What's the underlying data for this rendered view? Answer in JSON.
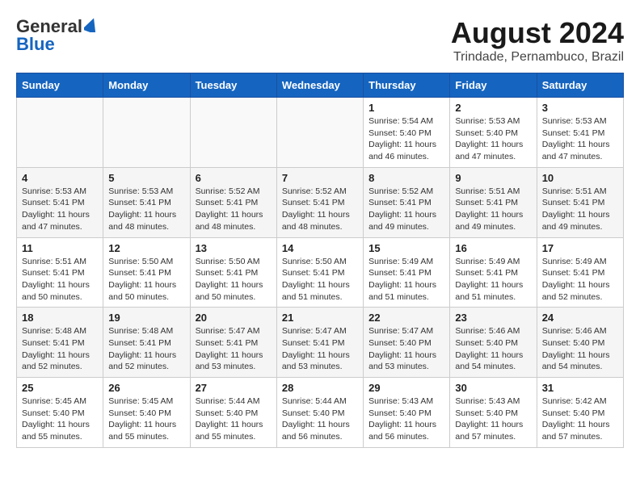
{
  "header": {
    "logo_line1": "General",
    "logo_line2": "Blue",
    "title": "August 2024",
    "subtitle": "Trindade, Pernambuco, Brazil"
  },
  "calendar": {
    "days_of_week": [
      "Sunday",
      "Monday",
      "Tuesday",
      "Wednesday",
      "Thursday",
      "Friday",
      "Saturday"
    ],
    "weeks": [
      [
        {
          "day": "",
          "empty": true
        },
        {
          "day": "",
          "empty": true
        },
        {
          "day": "",
          "empty": true
        },
        {
          "day": "",
          "empty": true
        },
        {
          "day": "1",
          "sunrise": "Sunrise: 5:54 AM",
          "sunset": "Sunset: 5:40 PM",
          "daylight": "Daylight: 11 hours and 46 minutes."
        },
        {
          "day": "2",
          "sunrise": "Sunrise: 5:53 AM",
          "sunset": "Sunset: 5:40 PM",
          "daylight": "Daylight: 11 hours and 47 minutes."
        },
        {
          "day": "3",
          "sunrise": "Sunrise: 5:53 AM",
          "sunset": "Sunset: 5:41 PM",
          "daylight": "Daylight: 11 hours and 47 minutes."
        }
      ],
      [
        {
          "day": "4",
          "sunrise": "Sunrise: 5:53 AM",
          "sunset": "Sunset: 5:41 PM",
          "daylight": "Daylight: 11 hours and 47 minutes."
        },
        {
          "day": "5",
          "sunrise": "Sunrise: 5:53 AM",
          "sunset": "Sunset: 5:41 PM",
          "daylight": "Daylight: 11 hours and 48 minutes."
        },
        {
          "day": "6",
          "sunrise": "Sunrise: 5:52 AM",
          "sunset": "Sunset: 5:41 PM",
          "daylight": "Daylight: 11 hours and 48 minutes."
        },
        {
          "day": "7",
          "sunrise": "Sunrise: 5:52 AM",
          "sunset": "Sunset: 5:41 PM",
          "daylight": "Daylight: 11 hours and 48 minutes."
        },
        {
          "day": "8",
          "sunrise": "Sunrise: 5:52 AM",
          "sunset": "Sunset: 5:41 PM",
          "daylight": "Daylight: 11 hours and 49 minutes."
        },
        {
          "day": "9",
          "sunrise": "Sunrise: 5:51 AM",
          "sunset": "Sunset: 5:41 PM",
          "daylight": "Daylight: 11 hours and 49 minutes."
        },
        {
          "day": "10",
          "sunrise": "Sunrise: 5:51 AM",
          "sunset": "Sunset: 5:41 PM",
          "daylight": "Daylight: 11 hours and 49 minutes."
        }
      ],
      [
        {
          "day": "11",
          "sunrise": "Sunrise: 5:51 AM",
          "sunset": "Sunset: 5:41 PM",
          "daylight": "Daylight: 11 hours and 50 minutes."
        },
        {
          "day": "12",
          "sunrise": "Sunrise: 5:50 AM",
          "sunset": "Sunset: 5:41 PM",
          "daylight": "Daylight: 11 hours and 50 minutes."
        },
        {
          "day": "13",
          "sunrise": "Sunrise: 5:50 AM",
          "sunset": "Sunset: 5:41 PM",
          "daylight": "Daylight: 11 hours and 50 minutes."
        },
        {
          "day": "14",
          "sunrise": "Sunrise: 5:50 AM",
          "sunset": "Sunset: 5:41 PM",
          "daylight": "Daylight: 11 hours and 51 minutes."
        },
        {
          "day": "15",
          "sunrise": "Sunrise: 5:49 AM",
          "sunset": "Sunset: 5:41 PM",
          "daylight": "Daylight: 11 hours and 51 minutes."
        },
        {
          "day": "16",
          "sunrise": "Sunrise: 5:49 AM",
          "sunset": "Sunset: 5:41 PM",
          "daylight": "Daylight: 11 hours and 51 minutes."
        },
        {
          "day": "17",
          "sunrise": "Sunrise: 5:49 AM",
          "sunset": "Sunset: 5:41 PM",
          "daylight": "Daylight: 11 hours and 52 minutes."
        }
      ],
      [
        {
          "day": "18",
          "sunrise": "Sunrise: 5:48 AM",
          "sunset": "Sunset: 5:41 PM",
          "daylight": "Daylight: 11 hours and 52 minutes."
        },
        {
          "day": "19",
          "sunrise": "Sunrise: 5:48 AM",
          "sunset": "Sunset: 5:41 PM",
          "daylight": "Daylight: 11 hours and 52 minutes."
        },
        {
          "day": "20",
          "sunrise": "Sunrise: 5:47 AM",
          "sunset": "Sunset: 5:41 PM",
          "daylight": "Daylight: 11 hours and 53 minutes."
        },
        {
          "day": "21",
          "sunrise": "Sunrise: 5:47 AM",
          "sunset": "Sunset: 5:41 PM",
          "daylight": "Daylight: 11 hours and 53 minutes."
        },
        {
          "day": "22",
          "sunrise": "Sunrise: 5:47 AM",
          "sunset": "Sunset: 5:40 PM",
          "daylight": "Daylight: 11 hours and 53 minutes."
        },
        {
          "day": "23",
          "sunrise": "Sunrise: 5:46 AM",
          "sunset": "Sunset: 5:40 PM",
          "daylight": "Daylight: 11 hours and 54 minutes."
        },
        {
          "day": "24",
          "sunrise": "Sunrise: 5:46 AM",
          "sunset": "Sunset: 5:40 PM",
          "daylight": "Daylight: 11 hours and 54 minutes."
        }
      ],
      [
        {
          "day": "25",
          "sunrise": "Sunrise: 5:45 AM",
          "sunset": "Sunset: 5:40 PM",
          "daylight": "Daylight: 11 hours and 55 minutes."
        },
        {
          "day": "26",
          "sunrise": "Sunrise: 5:45 AM",
          "sunset": "Sunset: 5:40 PM",
          "daylight": "Daylight: 11 hours and 55 minutes."
        },
        {
          "day": "27",
          "sunrise": "Sunrise: 5:44 AM",
          "sunset": "Sunset: 5:40 PM",
          "daylight": "Daylight: 11 hours and 55 minutes."
        },
        {
          "day": "28",
          "sunrise": "Sunrise: 5:44 AM",
          "sunset": "Sunset: 5:40 PM",
          "daylight": "Daylight: 11 hours and 56 minutes."
        },
        {
          "day": "29",
          "sunrise": "Sunrise: 5:43 AM",
          "sunset": "Sunset: 5:40 PM",
          "daylight": "Daylight: 11 hours and 56 minutes."
        },
        {
          "day": "30",
          "sunrise": "Sunrise: 5:43 AM",
          "sunset": "Sunset: 5:40 PM",
          "daylight": "Daylight: 11 hours and 57 minutes."
        },
        {
          "day": "31",
          "sunrise": "Sunrise: 5:42 AM",
          "sunset": "Sunset: 5:40 PM",
          "daylight": "Daylight: 11 hours and 57 minutes."
        }
      ]
    ]
  }
}
